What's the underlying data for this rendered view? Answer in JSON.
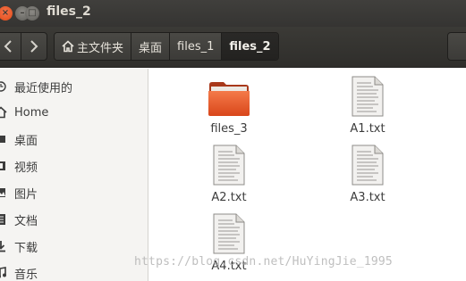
{
  "window": {
    "title": "files_2",
    "controls": {
      "close": "×",
      "minimize": "–",
      "maximize": "□"
    }
  },
  "toolbar": {
    "back_icon": "chevron-left-icon",
    "forward_icon": "chevron-right-icon"
  },
  "breadcrumb": [
    {
      "label": "主文件夹",
      "icon": "home-icon",
      "active": false
    },
    {
      "label": "桌面",
      "active": false
    },
    {
      "label": "files_1",
      "active": false
    },
    {
      "label": "files_2",
      "active": true
    }
  ],
  "sidebar": {
    "items": [
      {
        "label": "最近使用的",
        "icon": "clock-icon"
      },
      {
        "label": "Home",
        "icon": "home-icon"
      },
      {
        "label": "桌面",
        "icon": "desktop-icon"
      },
      {
        "label": "视频",
        "icon": "video-icon"
      },
      {
        "label": "图片",
        "icon": "image-icon"
      },
      {
        "label": "文档",
        "icon": "document-icon"
      },
      {
        "label": "下载",
        "icon": "download-icon"
      },
      {
        "label": "音乐",
        "icon": "music-icon"
      }
    ]
  },
  "files": [
    {
      "name": "files_3",
      "type": "folder"
    },
    {
      "name": "A1.txt",
      "type": "text"
    },
    {
      "name": "A2.txt",
      "type": "text"
    },
    {
      "name": "A3.txt",
      "type": "text"
    },
    {
      "name": "A4.txt",
      "type": "text"
    }
  ],
  "watermark": "https://blog.csdn.net/HuYingJie_1995",
  "colors": {
    "folder": "#e95420",
    "titlebar": "#3c3b37",
    "sidebar": "#f5f4f2"
  }
}
